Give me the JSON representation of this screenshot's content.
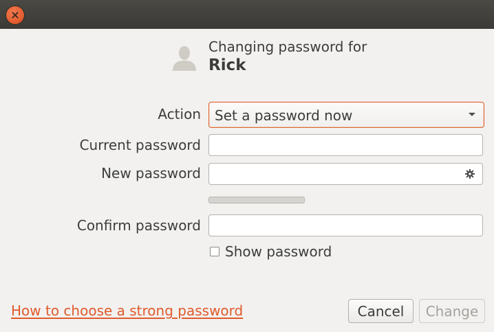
{
  "window": {
    "close_icon": "close-icon"
  },
  "header": {
    "subtitle": "Changing password for",
    "user_name": "Rick",
    "avatar_icon": "user-avatar-icon"
  },
  "form": {
    "action_label": "Action",
    "action_value": "Set a password now",
    "current_password_label": "Current password",
    "current_password_value": "",
    "new_password_label": "New password",
    "new_password_value": "",
    "new_password_icon": "gear-icon",
    "strength_level": 0,
    "confirm_password_label": "Confirm password",
    "confirm_password_value": "",
    "show_password_label": "Show password",
    "show_password_checked": false
  },
  "footer": {
    "help_link": "How to choose a strong password",
    "cancel_label": "Cancel",
    "change_label": "Change",
    "change_enabled": false
  },
  "colors": {
    "accent": "#e05a2b",
    "titlebar": "#3b3a36",
    "background": "#f2f1f0"
  }
}
